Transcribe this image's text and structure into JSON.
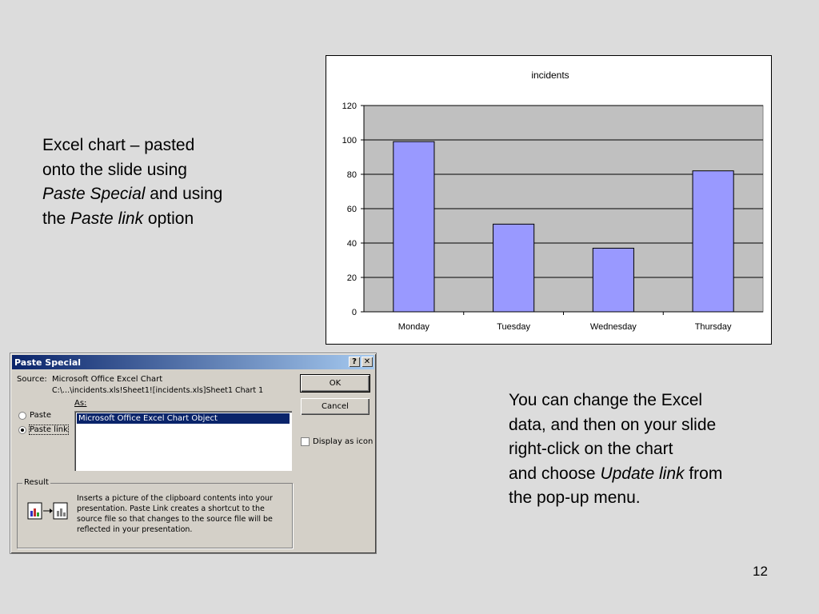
{
  "slide": {
    "left_text": {
      "line1": "Excel chart – pasted",
      "line2": "onto the slide using",
      "line3_italic": "Paste Special",
      "line3_rest": " and using",
      "line4_pre": "the ",
      "line4_italic": "Paste link",
      "line4_rest": " option"
    },
    "right_text": {
      "line1": "You can change the Excel",
      "line2": "data, and then on your slide",
      "line3": "right-click on the chart",
      "line4_pre": "and choose ",
      "line4_italic": "Update link",
      "line4_rest": " from",
      "line5": "the pop-up menu."
    },
    "page_number": "12"
  },
  "chart_data": {
    "type": "bar",
    "title": "incidents",
    "categories": [
      "Monday",
      "Tuesday",
      "Wednesday",
      "Thursday"
    ],
    "values": [
      99,
      51,
      37,
      82
    ],
    "ylim": [
      0,
      120
    ],
    "yticks": [
      "0",
      "20",
      "40",
      "60",
      "80",
      "100",
      "120"
    ],
    "grid": true,
    "bar_color": "#9999ff",
    "plot_background": "#c0c0c0"
  },
  "dialog": {
    "title": "Paste Special",
    "help_button": "?",
    "close_button": "✕",
    "source_label": "Source:",
    "source_line1": "Microsoft Office Excel Chart",
    "source_line2": "C:\\...\\incidents.xls!Sheet1![incidents.xls]Sheet1 Chart 1",
    "as_label": "As:",
    "options": {
      "paste_label": "Paste",
      "paste_link_label": "Paste link",
      "selected": "Paste link"
    },
    "list_items": [
      "Microsoft Office Excel Chart Object"
    ],
    "ok_label": "OK",
    "cancel_label": "Cancel",
    "display_as_icon_label": "Display as icon",
    "result_label": "Result",
    "result_text": "Inserts a picture of the clipboard contents into your presentation. Paste Link creates a shortcut to the source file so that changes to the source file will be reflected in your presentation."
  }
}
